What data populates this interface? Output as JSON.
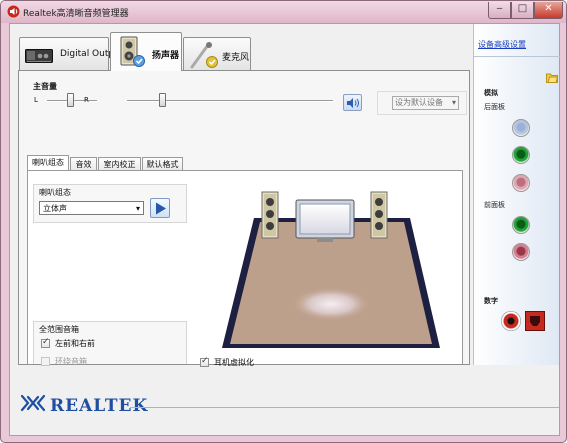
{
  "window": {
    "title": "Realtek高清晰音频管理器",
    "buttons": {
      "minimize": "‒",
      "maximize": "□",
      "close": "✕"
    }
  },
  "device_tabs": [
    {
      "label": "Digital Output",
      "active": false
    },
    {
      "label": "扬声器",
      "active": true
    },
    {
      "label": "麦克风",
      "active": false
    }
  ],
  "volume": {
    "title": "主音量",
    "left_label": "L",
    "right_label": "R",
    "balance": 0.45,
    "level": 0.17,
    "default_device_button": "设为默认设备"
  },
  "sub_tabs": [
    "喇叭组态",
    "音效",
    "室内校正",
    "默认格式"
  ],
  "speaker_config": {
    "group_title": "喇叭组态",
    "selected": "立体声"
  },
  "full_range": {
    "group_title": "全范围音箱",
    "front_left_right": {
      "label": "左前和右前",
      "checked": true,
      "enabled": true
    },
    "surround": {
      "label": "环绕音箱",
      "checked": false,
      "enabled": false
    }
  },
  "headphone_virtualization": {
    "label": "耳机虚拟化",
    "checked": true
  },
  "right_panel": {
    "advanced_link": "设备高级设置",
    "analog_label": "模拟",
    "back_panel_label": "后面板",
    "front_panel_label": "前面板",
    "digital_label": "数字"
  },
  "brand": {
    "name": "REALTEK"
  },
  "colors": {
    "title_bar": "#e3bccd",
    "jack_green": "#1a9a33",
    "jack_pink": "#d891a0",
    "jack_blue_gray": "#9bb2d8",
    "link_blue": "#1a3dc0",
    "floor": "#bda08b",
    "brand_blue": "#1f4fa0"
  },
  "icons": {
    "app": "speaker-icon",
    "play": "play-icon",
    "mute": "speaker-volume-icon",
    "folder": "folder-icon",
    "digital_optical": "optical-output-icon",
    "digital_coax": "coax-output-icon"
  }
}
